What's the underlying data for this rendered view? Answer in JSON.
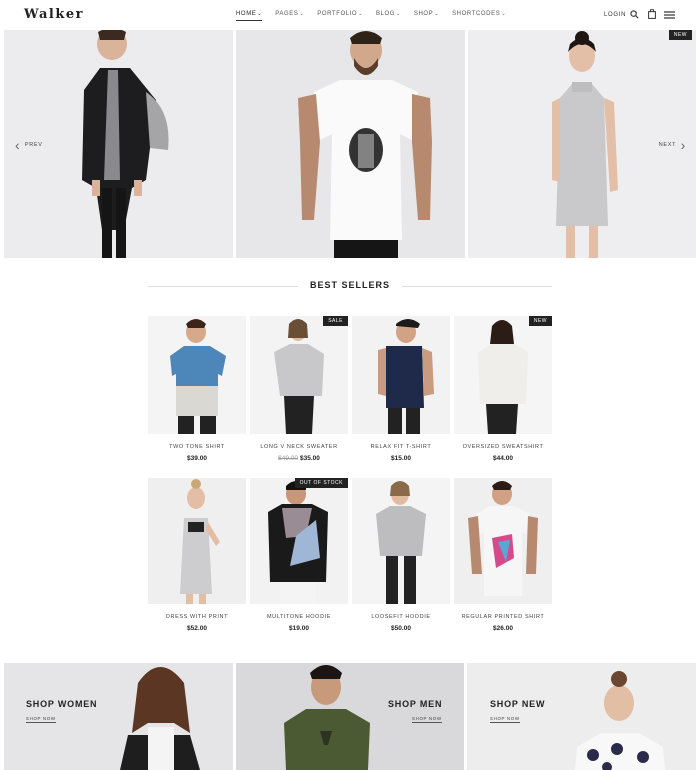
{
  "header": {
    "logo": "Walker",
    "nav": [
      {
        "label": "HOME",
        "active": true
      },
      {
        "label": "PAGES",
        "active": false
      },
      {
        "label": "PORTFOLIO",
        "active": false
      },
      {
        "label": "BLOG",
        "active": false
      },
      {
        "label": "SHOP",
        "active": false
      },
      {
        "label": "SHORTCODES",
        "active": false
      }
    ],
    "caret": "⌄",
    "login": "LOGIN",
    "icons": [
      "search-icon",
      "shopping-bag-icon",
      "hamburger-menu-icon"
    ]
  },
  "hero": {
    "prev_label": "PREV",
    "next_label": "NEXT",
    "new_badge": "NEW"
  },
  "best_sellers": {
    "title": "BEST SELLERS",
    "products": [
      {
        "name": "TWO TONE SHIRT",
        "price": "$39.00",
        "old_price": "",
        "badge": ""
      },
      {
        "name": "LONG V NECK SWEATER",
        "price": "$35.00",
        "old_price": "$49.00",
        "badge": "SALE"
      },
      {
        "name": "RELAX FIT T-SHIRT",
        "price": "$15.00",
        "old_price": "",
        "badge": ""
      },
      {
        "name": "OVERSIZED SWEATSHIRT",
        "price": "$44.00",
        "old_price": "",
        "badge": "NEW"
      },
      {
        "name": "DRESS WITH PRINT",
        "price": "$52.00",
        "old_price": "",
        "badge": ""
      },
      {
        "name": "MULTITONE HOODIE",
        "price": "$19.00",
        "old_price": "",
        "badge": "OUT OF STOCK"
      },
      {
        "name": "LOOSEFIT HOODIE",
        "price": "$50.00",
        "old_price": "",
        "badge": ""
      },
      {
        "name": "REGULAR PRINTED SHIRT",
        "price": "$26.00",
        "old_price": "",
        "badge": ""
      }
    ]
  },
  "banners": [
    {
      "title": "SHOP WOMEN",
      "link": "SHOP NOW"
    },
    {
      "title": "SHOP MEN",
      "link": "SHOP NOW"
    },
    {
      "title": "SHOP NEW",
      "link": "SHOP NOW"
    }
  ],
  "colors": {
    "text": "#222222",
    "badge_bg": "#222222",
    "background": "#ffffff",
    "divider": "#dddddd"
  }
}
